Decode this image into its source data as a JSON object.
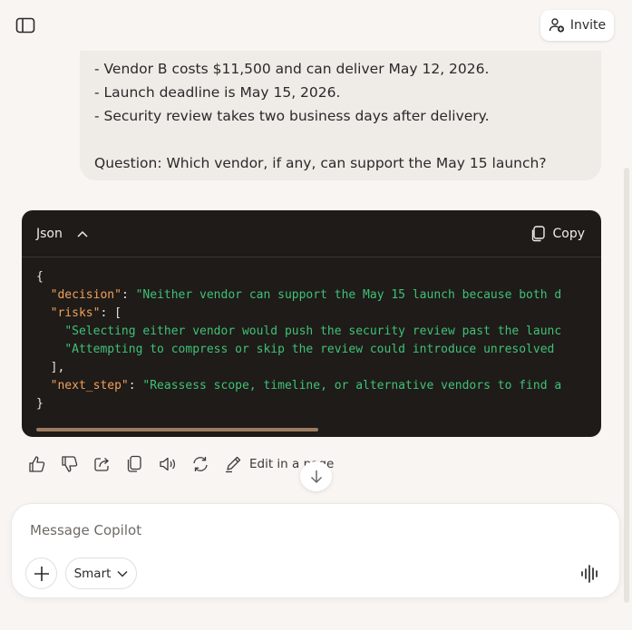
{
  "header": {
    "sidebar_toggle_icon": "sidebar-toggle-icon",
    "invite_label": "Invite",
    "invite_icon": "add-person-icon"
  },
  "user_message": {
    "lines": [
      "- Vendor B costs $11,500 and can deliver May 12, 2026.",
      "- Launch deadline is May 15, 2026.",
      "- Security review takes two business days after delivery.",
      "",
      "Question: Which vendor, if any, can support the May 15 launch?"
    ]
  },
  "code_block": {
    "language": "Json",
    "copy_label": "Copy",
    "line_1": "{",
    "decision_key": "\"decision\"",
    "decision_value": "\"Neither vendor can support the May 15 launch because both d",
    "risks_key": "\"risks\"",
    "risk_1": "\"Selecting either vendor would push the security review past the launc",
    "risk_2": "\"Attempting to compress or skip the review could introduce unresolved",
    "risks_close": "],",
    "next_step_key": "\"next_step\"",
    "next_step_value": "\"Reassess scope, timeline, or alternative vendors to find a",
    "line_last": "}"
  },
  "actions": {
    "items": [
      "thumbs-up-icon",
      "thumbs-down-icon",
      "share-icon",
      "copy-icon",
      "read-aloud-icon",
      "regenerate-icon"
    ],
    "edit_label": "Edit in a page"
  },
  "composer": {
    "placeholder": "Message Copilot",
    "mode_label": "Smart",
    "voice_icon": "voice-waveform-icon"
  },
  "colors": {
    "background": "#f8f5f2",
    "code_bg": "#1f1b19",
    "json_key": "#f0a15a",
    "json_string": "#3fc176"
  }
}
